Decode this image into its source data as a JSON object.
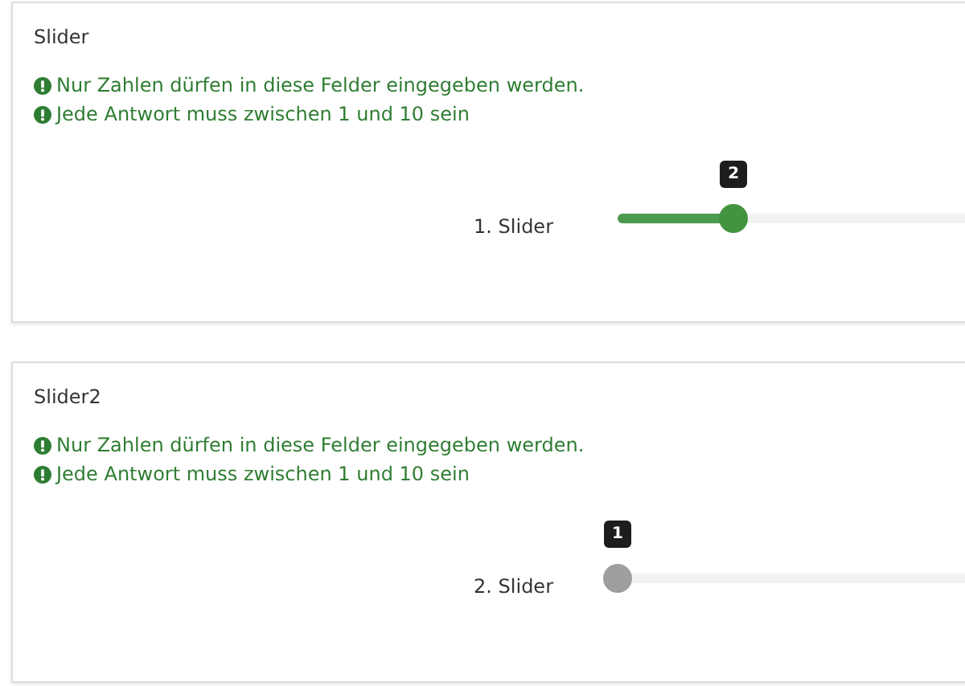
{
  "questions": [
    {
      "title": "Slider",
      "hints": [
        "Nur Zahlen dürfen in diese Felder eingegeben werden.",
        "Jede Antwort muss zwischen 1 und 10 sein"
      ],
      "slider": {
        "label": "1. Slider",
        "value": "2",
        "answered": true,
        "level": 0.111
      }
    },
    {
      "title": "Slider2",
      "hints": [
        "Nur Zahlen dürfen in diese Felder eingegeben werden.",
        "Jede Antwort muss zwischen 1 und 10 sein"
      ],
      "slider": {
        "label": "2. Slider",
        "value": "1",
        "answered": false,
        "level": 0
      }
    }
  ]
}
